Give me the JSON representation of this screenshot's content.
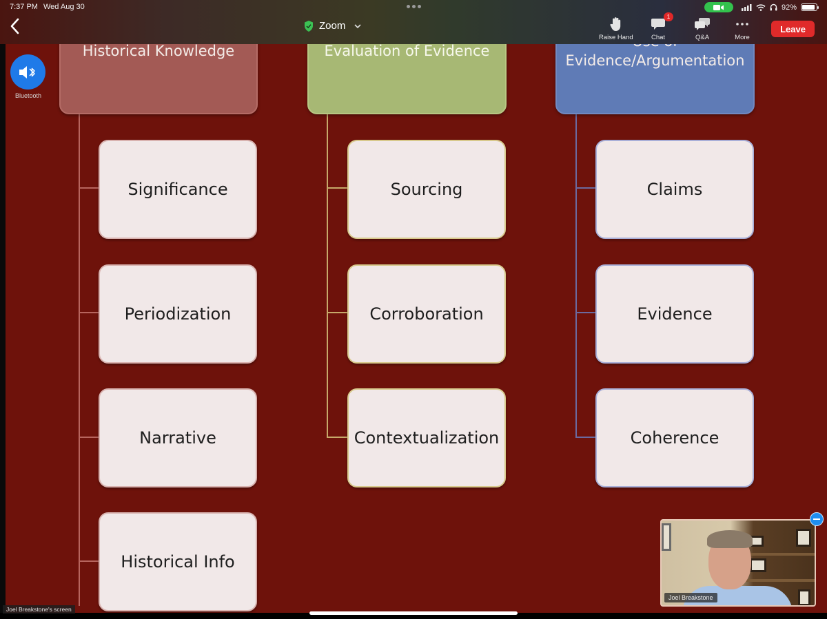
{
  "status_bar": {
    "time": "7:37 PM",
    "date": "Wed Aug 30",
    "battery": "92%",
    "battery_level": 0.92
  },
  "toolbar": {
    "meeting_title": "Zoom",
    "raise_hand": "Raise Hand",
    "chat": "Chat",
    "chat_badge": "1",
    "qa": "Q&A",
    "more": "More",
    "leave": "Leave"
  },
  "audio": {
    "label": "Bluetooth"
  },
  "slide": {
    "columns": [
      {
        "header": "Historical Knowledge",
        "header_color": "#a35a55",
        "items": [
          "Significance",
          "Periodization",
          "Narrative",
          "Historical Info"
        ]
      },
      {
        "header": "Evaluation of Evidence",
        "header_color": "#a7b874",
        "items": [
          "Sourcing",
          "Corroboration",
          "Contextualization"
        ]
      },
      {
        "header_line1": "Use of",
        "header_line2": "Evidence/Argumentation",
        "header_color": "#5f7bb6",
        "items": [
          "Claims",
          "Evidence",
          "Coherence"
        ]
      }
    ]
  },
  "video": {
    "participant_name": "Joel Breakstone"
  },
  "share": {
    "label": "Joel Breakstone's screen"
  },
  "colors": {
    "slide_background": "#6e120b",
    "leave_button": "#e02a2a",
    "bluetooth_button": "#1f7ae8",
    "camera_indicator": "#33c24d"
  }
}
